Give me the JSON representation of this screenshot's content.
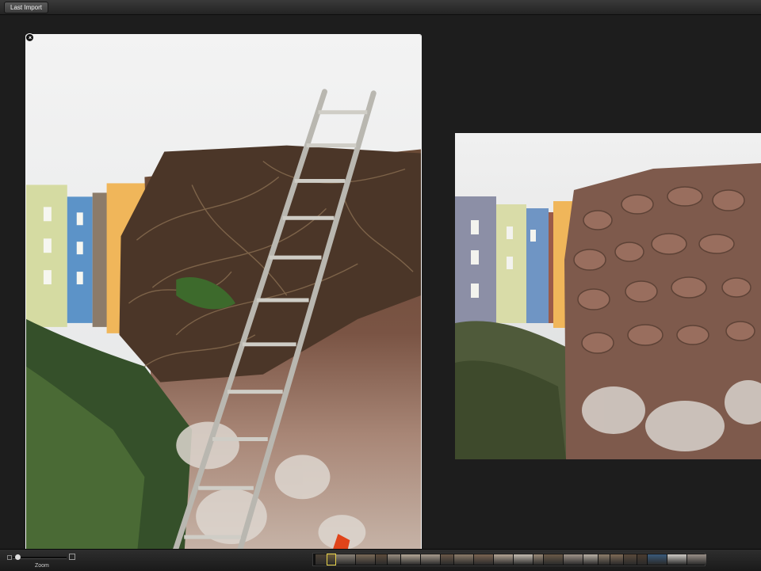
{
  "toolbar": {
    "source_label": "Last Import"
  },
  "viewer": {
    "main_photo": {
      "name": "ladder-wall-photo"
    },
    "side_photo": {
      "name": "stone-wall-photo"
    }
  },
  "zoom": {
    "label": "Zoom",
    "level": 0.05
  },
  "filmstrip": {
    "thumbnails": [
      {
        "color": "#4a4035"
      },
      {
        "color": "#6b5a3a",
        "selected": true
      },
      {
        "color": "#8a8278"
      },
      {
        "color": "#7a6a58"
      },
      {
        "color": "#5e4c3c"
      },
      {
        "color": "#9a8e80"
      },
      {
        "color": "#b4a898"
      },
      {
        "color": "#a89c8e"
      },
      {
        "color": "#6a5848"
      },
      {
        "color": "#8c7c6a"
      },
      {
        "color": "#7a6452"
      },
      {
        "color": "#b3a595"
      },
      {
        "color": "#c5bdb2"
      },
      {
        "color": "#9a8a78"
      },
      {
        "color": "#6b5a48"
      },
      {
        "color": "#a0948a"
      },
      {
        "color": "#b9b1a6"
      },
      {
        "color": "#8e7e6c"
      },
      {
        "color": "#7e6a56"
      },
      {
        "color": "#5a4a3c"
      },
      {
        "color": "#4a3c30"
      },
      {
        "color": "#3a5a7a"
      },
      {
        "color": "#d0ccc6"
      },
      {
        "color": "#9a9088"
      }
    ]
  }
}
